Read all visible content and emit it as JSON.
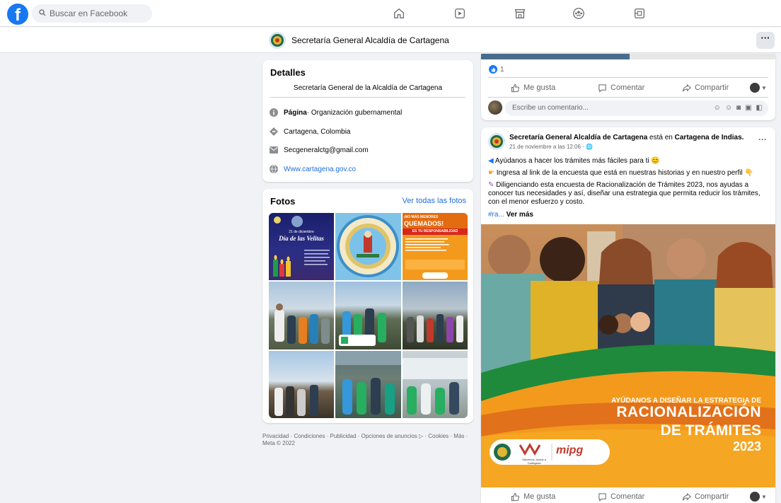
{
  "topbar": {
    "logo": "f",
    "search_placeholder": "Buscar en Facebook",
    "nav_icons": [
      "home-icon",
      "video-icon",
      "marketplace-icon",
      "groups-icon",
      "gaming-icon"
    ]
  },
  "page_header": {
    "name": "Secretaría General Alcaldía de Cartagena",
    "more": "···"
  },
  "details": {
    "title": "Detalles",
    "subtitle": "Secretaría General de la Alcaldía de Cartagena",
    "rows": [
      {
        "icon": "info-icon",
        "bold": "Página",
        "text": " · Organización gubernamental"
      },
      {
        "icon": "location-icon",
        "text": "Cartagena, Colombia"
      },
      {
        "icon": "email-icon",
        "text": "Secgeneralctg@gmail.com"
      },
      {
        "icon": "globe-icon",
        "text": "Www.cartagena.gov.co"
      }
    ]
  },
  "photos": {
    "title": "Fotos",
    "see_all": "Ver todas las fotos",
    "tile1_line1": "21 de diciembre",
    "tile1_line2": "Día de las Velitas",
    "tile3_line1": "¡NO MÁS MENORES",
    "tile3_line2": "QUEMADOS!",
    "tile3_line3": "ES TU RESPONSABILIDAD"
  },
  "footer": {
    "links": "Privacidad · Condiciones · Publicidad · Opciones de anuncios ▷ · Cookies · Más · Meta © 2022"
  },
  "post_top": {
    "reactions": "1",
    "like": "Me gusta",
    "comment": "Comentar",
    "share": "Compartir",
    "comment_placeholder": "Escribe un comentario..."
  },
  "post": {
    "author": "Secretaría General Alcaldía de Cartagena",
    "at_text": " está en ",
    "place": "Cartagena de Indias.",
    "meta": "21 de noviembre a las 12:06 · 🌐",
    "more": "···",
    "line1": "Ayúdanos a hacer los trámites más fáciles para ti 😊",
    "line2": "Ingresa al link de la encuesta que está en nuestras historias y en nuestro perfil 👇",
    "line3": "Diligenciando esta encuesta de Racionalización de Trámites 2023, nos ayudas a conocer tus necesidades y así, diseñar una estrategia que permita reducir los trámites, con el menor esfuerzo y costo.",
    "hashtag": "#ra...",
    "see_more": " Ver más",
    "image_line1": "AYÚDANOS A DISEÑAR LA ESTRATEGIA DE",
    "image_line2": "RACIONALIZACIÓN",
    "image_line3": "DE TRÁMITES",
    "image_line4": "2023",
    "image_logo1": "Salvemos Juntos a Cartagena",
    "image_logo2": "mipg",
    "like": "Me gusta",
    "comment": "Comentar",
    "share": "Compartir"
  },
  "colors": {
    "facebook_blue": "#1877f2",
    "link_blue": "#216fdb",
    "page_bg": "#f0f2f5",
    "image_orange": "#f39a1d",
    "image_green": "#1f8a3b"
  }
}
